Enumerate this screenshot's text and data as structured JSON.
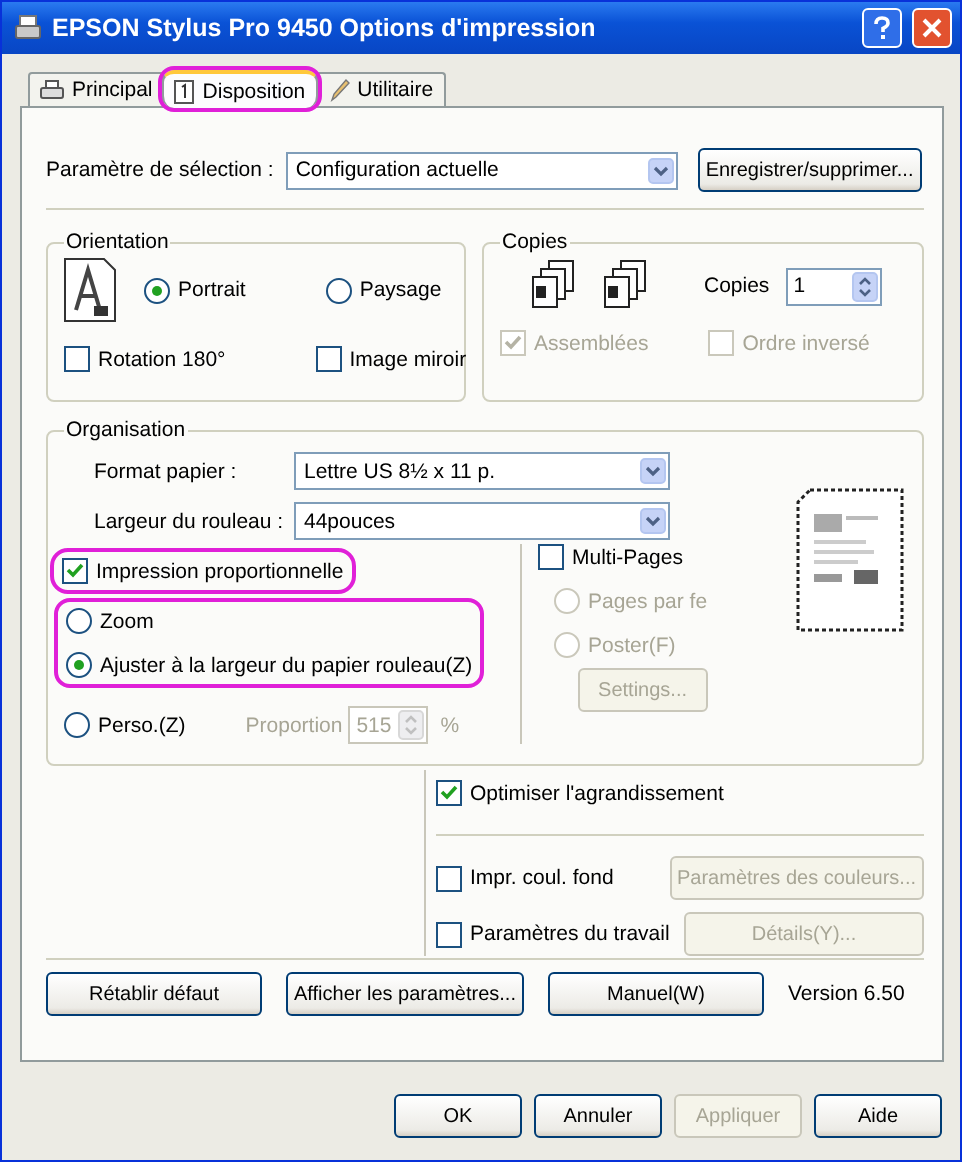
{
  "window": {
    "title": "EPSON Stylus Pro 9450 Options d'impression"
  },
  "tabs": [
    {
      "label": "Principal",
      "kind": "printer",
      "selected": false,
      "highlighted": false
    },
    {
      "label": "Disposition",
      "kind": "page",
      "selected": true,
      "highlighted": true
    },
    {
      "label": "Utilitaire",
      "kind": "pencil",
      "selected": false,
      "highlighted": false
    }
  ],
  "selection": {
    "label": "Paramètre de sélection :",
    "value": "Configuration actuelle",
    "button": "Enregistrer/supprimer..."
  },
  "orientation": {
    "title": "Orientation",
    "options": [
      {
        "label": "Portrait",
        "selected": true
      },
      {
        "label": "Paysage",
        "selected": false
      }
    ],
    "checkboxes": [
      {
        "label": "Rotation 180°",
        "checked": false
      },
      {
        "label": "Image miroir",
        "checked": false
      }
    ]
  },
  "copies": {
    "title": "Copies",
    "label": "Copies",
    "value": "1",
    "checkboxes": [
      {
        "label": "Assemblées",
        "checked": true,
        "disabled": true
      },
      {
        "label": "Ordre inversé",
        "checked": false,
        "disabled": true
      }
    ]
  },
  "organisation": {
    "title": "Organisation",
    "fields": [
      {
        "label": "Format papier :",
        "value": "Lettre US 8½ x 11 p."
      },
      {
        "label": "Largeur du rouleau :",
        "value": "44pouces"
      }
    ],
    "proportional": {
      "label": "Impression proportionnelle",
      "checked": true,
      "highlighted": true
    },
    "scale_options": [
      {
        "label": "Zoom",
        "selected": false,
        "highlighted": true
      },
      {
        "label": "Ajuster à la largeur du papier rouleau(Z)",
        "selected": true,
        "highlighted": true
      },
      {
        "label": "Perso.(Z)",
        "selected": false,
        "highlighted": false
      }
    ],
    "proportion": {
      "label": "Proportion",
      "value": "515",
      "unit": "%",
      "disabled": true
    },
    "multipage": {
      "label": "Multi-Pages",
      "checked": false,
      "options": [
        {
          "label": "Pages par fe",
          "selected": false,
          "disabled": true
        },
        {
          "label": "Poster(F)",
          "selected": false,
          "disabled": true
        }
      ],
      "button": {
        "label": "Settings...",
        "disabled": true
      }
    }
  },
  "options": [
    {
      "label": "Optimiser l'agrandissement",
      "checked": true
    },
    {
      "label": "Impr. coul. fond",
      "checked": false,
      "button": {
        "label": "Paramètres des couleurs...",
        "disabled": true
      }
    },
    {
      "label": "Paramètres du travail",
      "checked": false,
      "button": {
        "label": "Détails(Y)...",
        "disabled": true
      }
    }
  ],
  "actions": [
    "Rétablir défaut",
    "Afficher les paramètres...",
    "Manuel(W)"
  ],
  "version": "Version 6.50",
  "footer": [
    {
      "label": "OK",
      "disabled": false
    },
    {
      "label": "Annuler",
      "disabled": false
    },
    {
      "label": "Appliquer",
      "disabled": true
    },
    {
      "label": "Aide",
      "disabled": false
    }
  ]
}
